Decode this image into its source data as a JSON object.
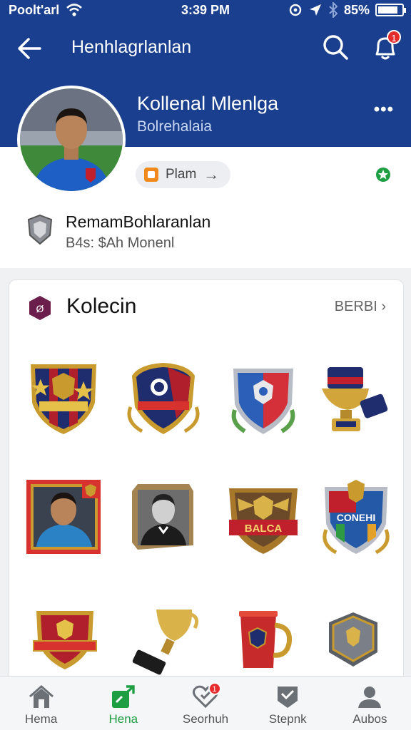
{
  "status_bar": {
    "carrier": "Poolt'arl",
    "time": "3:39 PM",
    "battery": "85%",
    "battery_level": 0.85
  },
  "app_bar": {
    "title": "Henhlagrlanlan",
    "notification_count": "1"
  },
  "profile": {
    "name": "Kollenal Mlenlga",
    "subtitle": "Bolrehalaia",
    "chip_label": "Plam",
    "club_name": "RemamBohlaranlan",
    "club_sub": "B4s: $Ah Monenl"
  },
  "collection": {
    "title": "Kolecin",
    "see_all": "BERBI",
    "items": [
      {
        "kind": "crest",
        "label": ""
      },
      {
        "kind": "crest",
        "label": ""
      },
      {
        "kind": "crest",
        "label": ""
      },
      {
        "kind": "trophy",
        "label": ""
      },
      {
        "kind": "player-card",
        "label": ""
      },
      {
        "kind": "player-card",
        "label": ""
      },
      {
        "kind": "crest",
        "label": "BALCA"
      },
      {
        "kind": "crest",
        "label": "CONEHI"
      },
      {
        "kind": "crest",
        "label": ""
      },
      {
        "kind": "trophy",
        "label": ""
      },
      {
        "kind": "mug",
        "label": ""
      },
      {
        "kind": "badge",
        "label": ""
      }
    ]
  },
  "tabs": [
    {
      "label": "Hema",
      "icon": "home-icon",
      "active": false
    },
    {
      "label": "Hena",
      "icon": "swap-icon",
      "active": true
    },
    {
      "label": "Seorhuh",
      "icon": "heart-icon",
      "active": false,
      "badge": "1"
    },
    {
      "label": "Stepnk",
      "icon": "check-shield-icon",
      "active": false
    },
    {
      "label": "Aubos",
      "icon": "person-icon",
      "active": false
    }
  ],
  "colors": {
    "brand": "#1a3f8f",
    "accent": "#1e9e42",
    "badge": "#e52b2b"
  }
}
